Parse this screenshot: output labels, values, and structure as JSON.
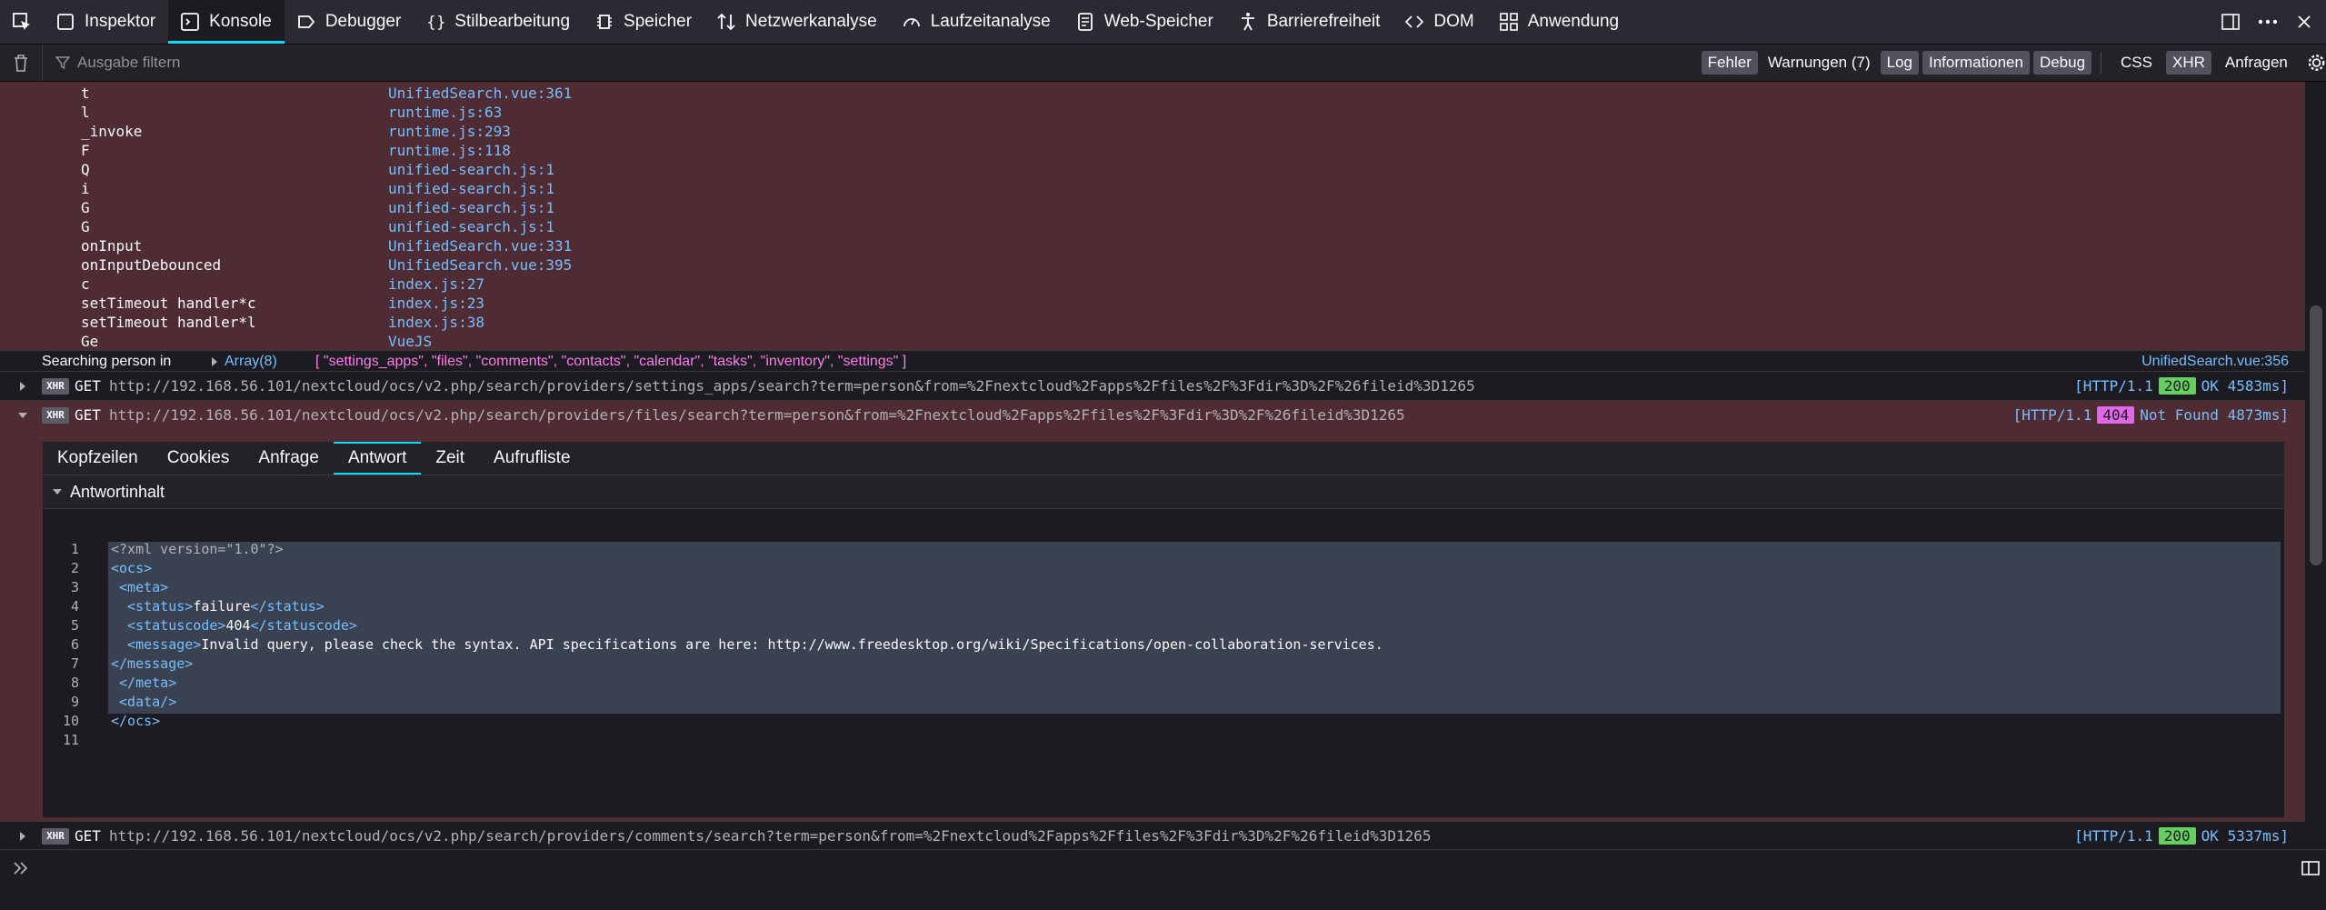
{
  "toolbar": {
    "tabs": [
      {
        "label": "Inspektor",
        "icon": "inspector-icon"
      },
      {
        "label": "Konsole",
        "icon": "console-icon"
      },
      {
        "label": "Debugger",
        "icon": "debugger-icon"
      },
      {
        "label": "Stilbearbeitung",
        "icon": "style-editor-icon"
      },
      {
        "label": "Speicher",
        "icon": "memory-icon"
      },
      {
        "label": "Netzwerkanalyse",
        "icon": "network-icon"
      },
      {
        "label": "Laufzeitanalyse",
        "icon": "performance-icon"
      },
      {
        "label": "Web-Speicher",
        "icon": "storage-icon"
      },
      {
        "label": "Barrierefreiheit",
        "icon": "accessibility-icon"
      },
      {
        "label": "DOM",
        "icon": "dom-icon"
      },
      {
        "label": "Anwendung",
        "icon": "application-icon"
      }
    ]
  },
  "filterbar": {
    "placeholder": "Ausgabe filtern",
    "levels": [
      "Fehler",
      "Warnungen (7)",
      "Log",
      "Informationen",
      "Debug"
    ],
    "extras": [
      "CSS",
      "XHR",
      "Anfragen"
    ]
  },
  "stack_frames": [
    {
      "fn": "t",
      "loc": "UnifiedSearch.vue:361"
    },
    {
      "fn": "l",
      "loc": "runtime.js:63"
    },
    {
      "fn": "_invoke",
      "loc": "runtime.js:293"
    },
    {
      "fn": "F",
      "loc": "runtime.js:118"
    },
    {
      "fn": "Q",
      "loc": "unified-search.js:1"
    },
    {
      "fn": "i",
      "loc": "unified-search.js:1"
    },
    {
      "fn": "G",
      "loc": "unified-search.js:1"
    },
    {
      "fn": "G",
      "loc": "unified-search.js:1"
    },
    {
      "fn": "onInput",
      "loc": "UnifiedSearch.vue:331"
    },
    {
      "fn": "onInputDebounced",
      "loc": "UnifiedSearch.vue:395"
    },
    {
      "fn": "c",
      "loc": "index.js:27"
    },
    {
      "fn": "setTimeout handler*c",
      "loc": "index.js:23"
    },
    {
      "fn": "setTimeout handler*l",
      "loc": "index.js:38"
    },
    {
      "fn": "Ge",
      "loc": "VueJS"
    }
  ],
  "log_message": {
    "prefix": "Searching person in",
    "array_label": "Array(8)",
    "items": "[ \"settings_apps\", \"files\", \"comments\", \"contacts\", \"calendar\", \"tasks\", \"inventory\", \"settings\" ]",
    "location": "UnifiedSearch.vue:356"
  },
  "requests": [
    {
      "badge": "XHR",
      "method": "GET",
      "url": "http://192.168.56.101/nextcloud/ocs/v2.php/search/providers/settings_apps/search?term=person&from=%2Fnextcloud%2Fapps%2Ffiles%2F%3Fdir%3D%2F%26fileid%3D1265",
      "proto": "[HTTP/1.1",
      "code": "200",
      "status": "OK 4583ms]"
    },
    {
      "badge": "XHR",
      "method": "GET",
      "url": "http://192.168.56.101/nextcloud/ocs/v2.php/search/providers/files/search?term=person&from=%2Fnextcloud%2Fapps%2Ffiles%2F%3Fdir%3D%2F%26fileid%3D1265",
      "proto": "[HTTP/1.1",
      "code": "404",
      "status": "Not Found 4873ms]"
    },
    {
      "badge": "XHR",
      "method": "GET",
      "url": "http://192.168.56.101/nextcloud/ocs/v2.php/search/providers/comments/search?term=person&from=%2Fnextcloud%2Fapps%2Ffiles%2F%3Fdir%3D%2F%26fileid%3D1265",
      "proto": "[HTTP/1.1",
      "code": "200",
      "status": "OK 5337ms]"
    }
  ],
  "details": {
    "tabs": [
      "Kopfzeilen",
      "Cookies",
      "Anfrage",
      "Antwort",
      "Zeit",
      "Aufrufliste"
    ],
    "active_tab": "Antwort",
    "section": "Antwortinhalt",
    "code_lines": [
      {
        "n": "1",
        "text": "<?xml version=\"1.0\"?>"
      },
      {
        "n": "2",
        "text": "<ocs>"
      },
      {
        "n": "3",
        "text": " <meta>"
      },
      {
        "n": "4",
        "text": "  <status>failure</status>"
      },
      {
        "n": "5",
        "text": "  <statuscode>404</statuscode>"
      },
      {
        "n": "6",
        "text": "  <message>Invalid query, please check the syntax. API specifications are here: http://www.freedesktop.org/wiki/Specifications/open-collaboration-services.</message>"
      },
      {
        "n": "7",
        "text": " </meta>"
      },
      {
        "n": "8",
        "text": " <data/>"
      },
      {
        "n": "9",
        "text": "</ocs>"
      },
      {
        "n": "10",
        "text": ""
      },
      {
        "n": "11",
        "text": ""
      }
    ],
    "code_display": [
      {
        "n": "1",
        "parts": [
          [
            "pi",
            "<?xml version=\"1.0\"?>"
          ]
        ]
      },
      {
        "n": "2",
        "parts": [
          [
            "tag",
            "<ocs>"
          ]
        ]
      },
      {
        "n": "3",
        "parts": [
          [
            "tag",
            " <meta>"
          ]
        ]
      },
      {
        "n": "4",
        "parts": [
          [
            "tag",
            "  <status>"
          ],
          [
            "txt",
            "failure"
          ],
          [
            "tag",
            "</status>"
          ]
        ]
      },
      {
        "n": "5",
        "parts": [
          [
            "tag",
            "  <statuscode>"
          ],
          [
            "txt",
            "404"
          ],
          [
            "tag",
            "</statuscode>"
          ]
        ]
      },
      {
        "n": "6",
        "parts": [
          [
            "tag",
            "  <message>"
          ],
          [
            "txt",
            "Invalid query, please check the syntax. API specifications are here: http://www.freedesktop.org/wiki/Specifications/open-collaboration-services."
          ]
        ]
      },
      {
        "n": "7",
        "parts": [
          [
            "tag",
            "</message>"
          ]
        ]
      },
      {
        "n": "8",
        "parts": [
          [
            "tag",
            " </meta>"
          ]
        ]
      },
      {
        "n": "9",
        "parts": [
          [
            "tag",
            " <data/>"
          ]
        ]
      },
      {
        "n": "10",
        "parts": [
          [
            "tag",
            "</ocs>"
          ]
        ]
      },
      {
        "n": "11",
        "parts": []
      }
    ]
  },
  "colors": {
    "accent": "#00ddff",
    "link": "#75bfff",
    "string": "#ff7de9",
    "error_bg": "#4f2b33",
    "ok": "#64ce5e",
    "notfound": "#e068e6"
  }
}
